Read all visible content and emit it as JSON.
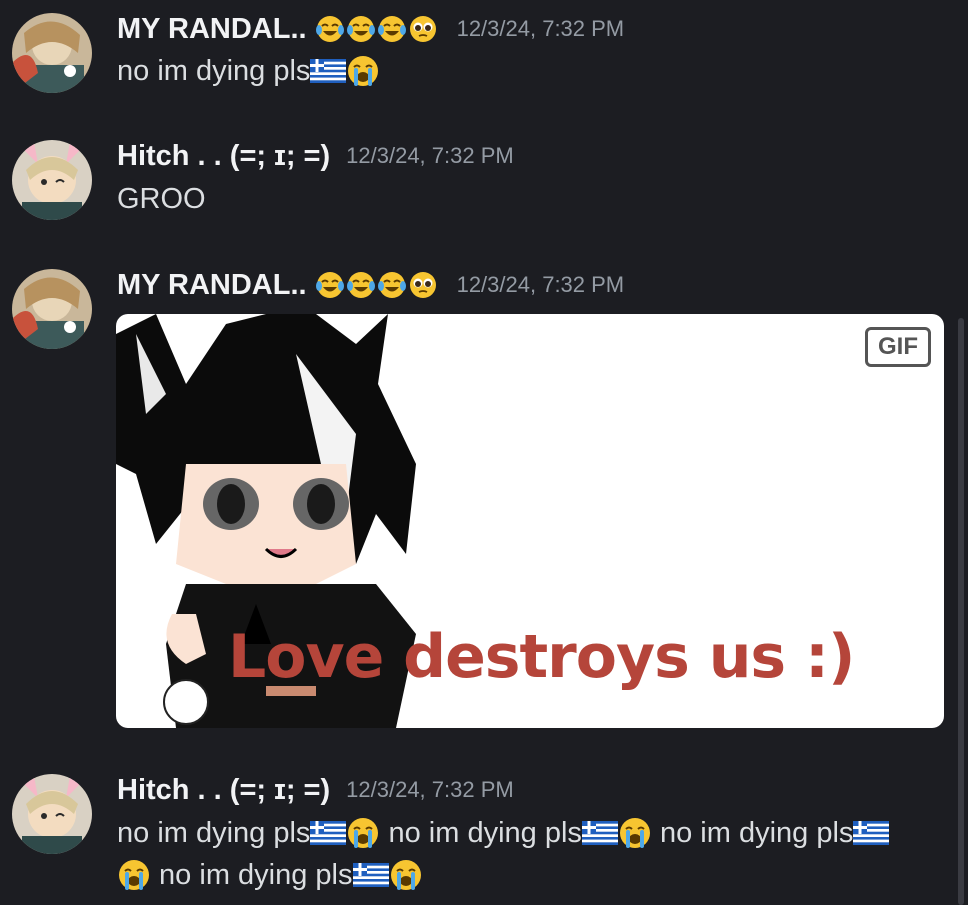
{
  "messages": [
    {
      "author": "MY RANDAL..",
      "author_emojis": [
        "joy-emoji",
        "joy-emoji",
        "joy-emoji",
        "pleading-emoji"
      ],
      "timestamp": "12/3/24, 7:32 PM",
      "text": "no im dying pls"
    },
    {
      "author": "Hitch . . (=;  ɪ;  =)",
      "timestamp": "12/3/24, 7:32 PM",
      "text": "GROO"
    },
    {
      "author": "MY RANDAL..",
      "author_emojis": [
        "joy-emoji",
        "joy-emoji",
        "joy-emoji",
        "pleading-emoji"
      ],
      "timestamp": "12/3/24, 7:32 PM",
      "attachment": {
        "type": "gif",
        "badge": "GIF",
        "caption": "Love destroys us :)"
      }
    },
    {
      "author": "Hitch . . (=;  ɪ;  =)",
      "timestamp": "12/3/24, 7:32 PM",
      "segments": [
        "no im dying pls",
        " no im dying pls",
        " no im dying pls",
        " no im dying pls"
      ]
    }
  ],
  "colors": {
    "background": "#1c1d22",
    "username": "#f2f3f5",
    "timestamp": "#949ba4",
    "message_text": "#dbdee1"
  }
}
